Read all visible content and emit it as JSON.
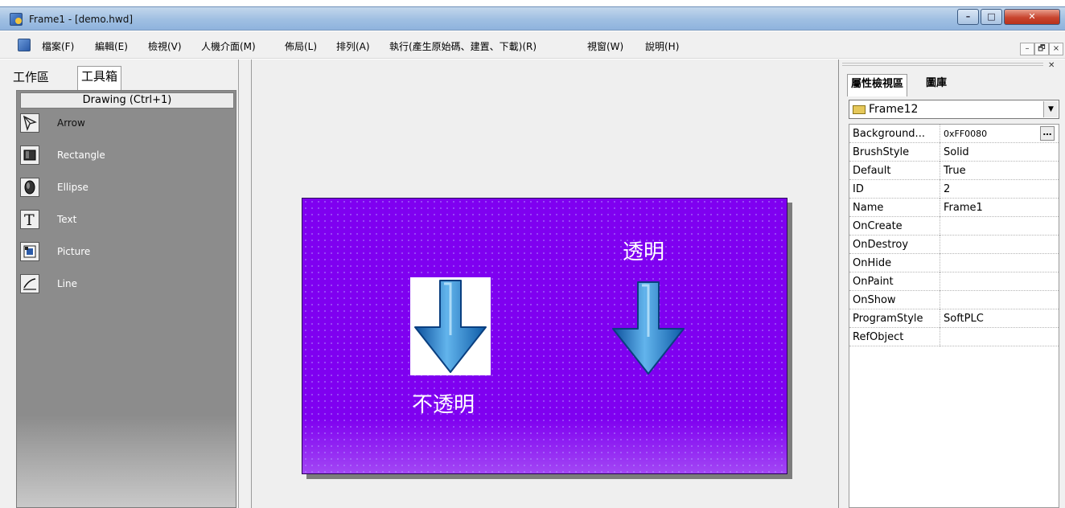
{
  "window": {
    "title": "Frame1 - [demo.hwd]"
  },
  "window_controls": {
    "minimize": "–",
    "maximize": "□",
    "close": "✕"
  },
  "menu": {
    "items": [
      "檔案(F)",
      "編輯(E)",
      "檢視(V)",
      "人機介面(M)",
      "佈局(L)",
      "排列(A)",
      "執行(產生原始碼、建置、下載)(R)",
      "視窗(W)",
      "說明(H)"
    ],
    "mdi_controls": {
      "minimize": "–",
      "restore": "🗗",
      "close": "×"
    }
  },
  "left_pane": {
    "tabs": [
      "工作區",
      "工具箱"
    ],
    "active_tab": "工具箱",
    "group_header": "Drawing (Ctrl+1)",
    "tools": [
      {
        "label": "Arrow",
        "icon": "arrow-pointer-icon"
      },
      {
        "label": "Rectangle",
        "icon": "rectangle-icon"
      },
      {
        "label": "Ellipse",
        "icon": "ellipse-icon"
      },
      {
        "label": "Text",
        "icon": "text-icon"
      },
      {
        "label": "Picture",
        "icon": "picture-icon"
      },
      {
        "label": "Line",
        "icon": "line-icon"
      }
    ]
  },
  "canvas": {
    "background_color": "#7F00F0",
    "label_opaque": "不透明",
    "label_transparent": "透明"
  },
  "right_pane": {
    "tabs": [
      "屬性檢視區",
      "圖庫"
    ],
    "active_tab": "屬性檢視區",
    "selected_object": "Frame12",
    "properties": [
      {
        "name": "Background...",
        "value": "0xFF0080"
      },
      {
        "name": "BrushStyle",
        "value": "Solid"
      },
      {
        "name": "Default",
        "value": "True"
      },
      {
        "name": "ID",
        "value": "2"
      },
      {
        "name": "Name",
        "value": "Frame1"
      },
      {
        "name": "OnCreate",
        "value": ""
      },
      {
        "name": "OnDestroy",
        "value": ""
      },
      {
        "name": "OnHide",
        "value": ""
      },
      {
        "name": "OnPaint",
        "value": ""
      },
      {
        "name": "OnShow",
        "value": ""
      },
      {
        "name": "ProgramStyle",
        "value": "SoftPLC"
      },
      {
        "name": "RefObject",
        "value": ""
      }
    ],
    "ellipsis_button": "…"
  }
}
